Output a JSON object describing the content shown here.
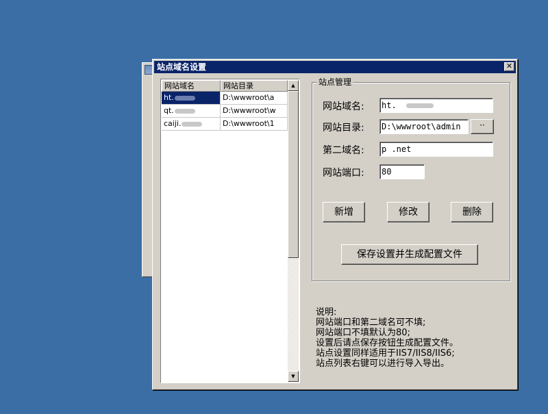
{
  "window": {
    "title": "站点域名设置",
    "close_glyph": "✕"
  },
  "site_list": {
    "columns": [
      "网站域名",
      "网站目录"
    ],
    "rows": [
      {
        "domain": "ht.",
        "directory": "D:\\wwwroot\\a",
        "selected": true
      },
      {
        "domain": "qt.",
        "directory": "D:\\wwwroot\\w",
        "selected": false
      },
      {
        "domain": "caiji.",
        "directory": "D:\\wwwroot\\1",
        "selected": false
      }
    ]
  },
  "site_manage": {
    "group_title": "站点管理",
    "domain_label": "网站域名:",
    "domain_value": "ht.",
    "directory_label": "网站目录:",
    "directory_value": "D:\\wwwroot\\admin",
    "browse_label": "··",
    "second_domain_label": "第二域名:",
    "second_domain_value": "p         .net",
    "port_label": "网站端口:",
    "port_value": "80",
    "add_label": "新增",
    "modify_label": "修改",
    "delete_label": "删除",
    "save_label": "保存设置并生成配置文件"
  },
  "notes": {
    "lines": [
      "说明:",
      "网站端口和第二域名可不填;",
      "网站端口不填默认为80;",
      "设置后请点保存按钮生成配置文件。",
      "站点设置同样适用于IIS7/IIS8/IIS6;",
      "站点列表右键可以进行导入导出。"
    ]
  },
  "icons": {
    "scroll_up": "▲",
    "scroll_down": "▼"
  }
}
